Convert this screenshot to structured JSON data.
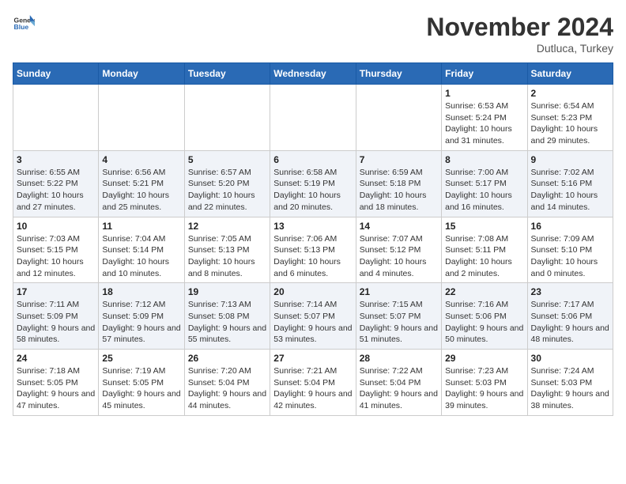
{
  "header": {
    "logo": {
      "general": "General",
      "blue": "Blue"
    },
    "title": "November 2024",
    "location": "Dutluca, Turkey"
  },
  "days_of_week": [
    "Sunday",
    "Monday",
    "Tuesday",
    "Wednesday",
    "Thursday",
    "Friday",
    "Saturday"
  ],
  "weeks": [
    [
      {
        "day": "",
        "info": ""
      },
      {
        "day": "",
        "info": ""
      },
      {
        "day": "",
        "info": ""
      },
      {
        "day": "",
        "info": ""
      },
      {
        "day": "",
        "info": ""
      },
      {
        "day": "1",
        "info": "Sunrise: 6:53 AM\nSunset: 5:24 PM\nDaylight: 10 hours and 31 minutes."
      },
      {
        "day": "2",
        "info": "Sunrise: 6:54 AM\nSunset: 5:23 PM\nDaylight: 10 hours and 29 minutes."
      }
    ],
    [
      {
        "day": "3",
        "info": "Sunrise: 6:55 AM\nSunset: 5:22 PM\nDaylight: 10 hours and 27 minutes."
      },
      {
        "day": "4",
        "info": "Sunrise: 6:56 AM\nSunset: 5:21 PM\nDaylight: 10 hours and 25 minutes."
      },
      {
        "day": "5",
        "info": "Sunrise: 6:57 AM\nSunset: 5:20 PM\nDaylight: 10 hours and 22 minutes."
      },
      {
        "day": "6",
        "info": "Sunrise: 6:58 AM\nSunset: 5:19 PM\nDaylight: 10 hours and 20 minutes."
      },
      {
        "day": "7",
        "info": "Sunrise: 6:59 AM\nSunset: 5:18 PM\nDaylight: 10 hours and 18 minutes."
      },
      {
        "day": "8",
        "info": "Sunrise: 7:00 AM\nSunset: 5:17 PM\nDaylight: 10 hours and 16 minutes."
      },
      {
        "day": "9",
        "info": "Sunrise: 7:02 AM\nSunset: 5:16 PM\nDaylight: 10 hours and 14 minutes."
      }
    ],
    [
      {
        "day": "10",
        "info": "Sunrise: 7:03 AM\nSunset: 5:15 PM\nDaylight: 10 hours and 12 minutes."
      },
      {
        "day": "11",
        "info": "Sunrise: 7:04 AM\nSunset: 5:14 PM\nDaylight: 10 hours and 10 minutes."
      },
      {
        "day": "12",
        "info": "Sunrise: 7:05 AM\nSunset: 5:13 PM\nDaylight: 10 hours and 8 minutes."
      },
      {
        "day": "13",
        "info": "Sunrise: 7:06 AM\nSunset: 5:13 PM\nDaylight: 10 hours and 6 minutes."
      },
      {
        "day": "14",
        "info": "Sunrise: 7:07 AM\nSunset: 5:12 PM\nDaylight: 10 hours and 4 minutes."
      },
      {
        "day": "15",
        "info": "Sunrise: 7:08 AM\nSunset: 5:11 PM\nDaylight: 10 hours and 2 minutes."
      },
      {
        "day": "16",
        "info": "Sunrise: 7:09 AM\nSunset: 5:10 PM\nDaylight: 10 hours and 0 minutes."
      }
    ],
    [
      {
        "day": "17",
        "info": "Sunrise: 7:11 AM\nSunset: 5:09 PM\nDaylight: 9 hours and 58 minutes."
      },
      {
        "day": "18",
        "info": "Sunrise: 7:12 AM\nSunset: 5:09 PM\nDaylight: 9 hours and 57 minutes."
      },
      {
        "day": "19",
        "info": "Sunrise: 7:13 AM\nSunset: 5:08 PM\nDaylight: 9 hours and 55 minutes."
      },
      {
        "day": "20",
        "info": "Sunrise: 7:14 AM\nSunset: 5:07 PM\nDaylight: 9 hours and 53 minutes."
      },
      {
        "day": "21",
        "info": "Sunrise: 7:15 AM\nSunset: 5:07 PM\nDaylight: 9 hours and 51 minutes."
      },
      {
        "day": "22",
        "info": "Sunrise: 7:16 AM\nSunset: 5:06 PM\nDaylight: 9 hours and 50 minutes."
      },
      {
        "day": "23",
        "info": "Sunrise: 7:17 AM\nSunset: 5:06 PM\nDaylight: 9 hours and 48 minutes."
      }
    ],
    [
      {
        "day": "24",
        "info": "Sunrise: 7:18 AM\nSunset: 5:05 PM\nDaylight: 9 hours and 47 minutes."
      },
      {
        "day": "25",
        "info": "Sunrise: 7:19 AM\nSunset: 5:05 PM\nDaylight: 9 hours and 45 minutes."
      },
      {
        "day": "26",
        "info": "Sunrise: 7:20 AM\nSunset: 5:04 PM\nDaylight: 9 hours and 44 minutes."
      },
      {
        "day": "27",
        "info": "Sunrise: 7:21 AM\nSunset: 5:04 PM\nDaylight: 9 hours and 42 minutes."
      },
      {
        "day": "28",
        "info": "Sunrise: 7:22 AM\nSunset: 5:04 PM\nDaylight: 9 hours and 41 minutes."
      },
      {
        "day": "29",
        "info": "Sunrise: 7:23 AM\nSunset: 5:03 PM\nDaylight: 9 hours and 39 minutes."
      },
      {
        "day": "30",
        "info": "Sunrise: 7:24 AM\nSunset: 5:03 PM\nDaylight: 9 hours and 38 minutes."
      }
    ]
  ]
}
